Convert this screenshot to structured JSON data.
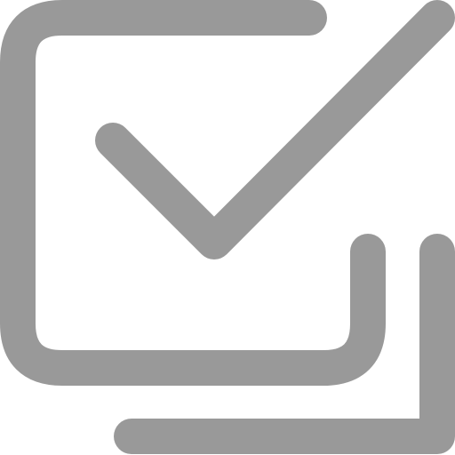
{
  "icon": {
    "name": "checkbox-multiple-icon",
    "color": "#999999",
    "background": "#ffffff"
  }
}
